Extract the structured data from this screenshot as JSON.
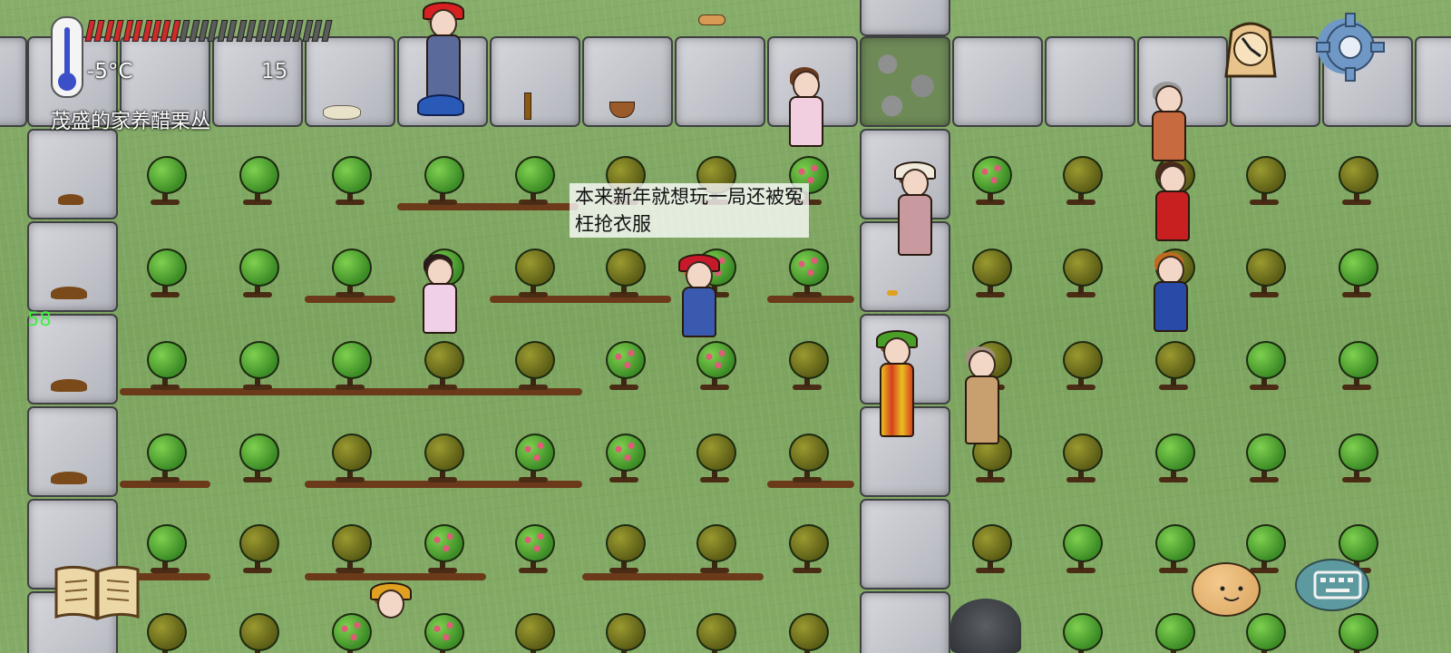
{
  "hud": {
    "temperature": "-5°C",
    "age": "15",
    "held_object_label": "茂盛的家养醋栗丛",
    "fps": "58",
    "food_pips_total": 26,
    "food_pips_filled": 10
  },
  "chat": {
    "speech_line1": "本来新年就想玩一局还被冤",
    "speech_line2": "枉抢衣服"
  },
  "icons": {
    "thermometer": "thermometer-icon",
    "clock": "clock-icon",
    "settings": "gear-icon",
    "book": "book-icon",
    "emote": "emote-face-icon",
    "keyboard": "keyboard-icon"
  },
  "colors": {
    "grass": "#7fa862",
    "stone": "#c4c6cc",
    "food_full": "#d22a2a",
    "fps_text": "#3ef03e",
    "settings_blue": "#6f98c6"
  }
}
